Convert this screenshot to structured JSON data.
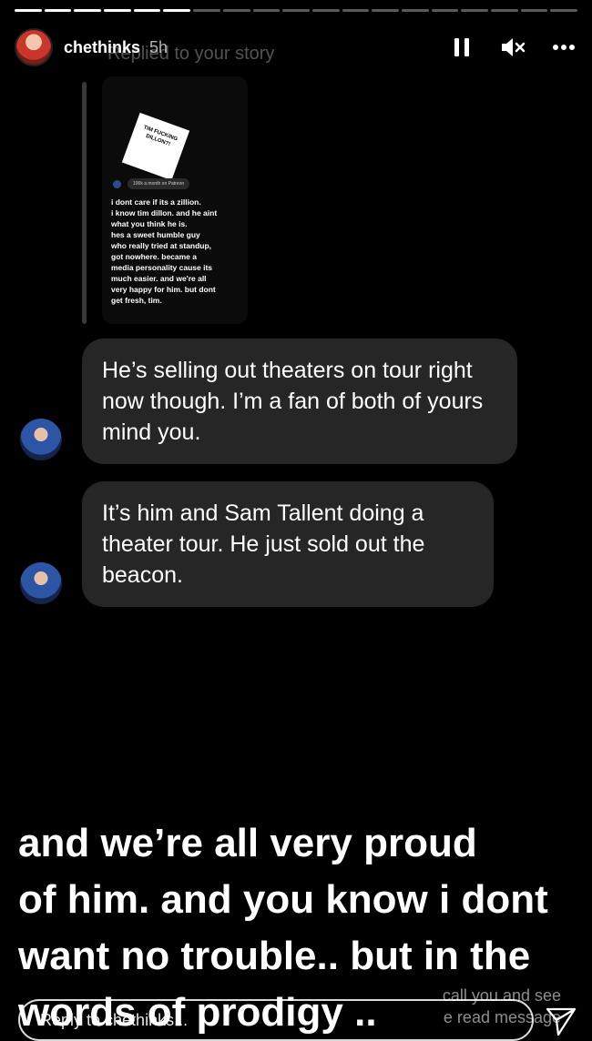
{
  "progress": {
    "segments": 19,
    "completed": 6
  },
  "header": {
    "username": "chethinks",
    "time_ago": "5h",
    "replied_to": "Replied to your story"
  },
  "quoted_story": {
    "mini_top": "",
    "mini_time": "",
    "mini_reply": "",
    "mini_story_text": "TIM FUCKING DILLON?!",
    "mini_pill": "100k a month on Patreon",
    "text_lines": [
      "i dont care if its a zillion.",
      "i know tim dillon. and he aint",
      "what you think he is.",
      "hes a sweet humble guy",
      "who really tried at standup,",
      "got nowhere. became a",
      "media personality cause its",
      "much easier. and we're all",
      "very happy for him. but dont",
      "get fresh, tim."
    ]
  },
  "messages": [
    {
      "text": "He’s selling out theaters on tour right now though. I’m a fan of both of yours mind you."
    },
    {
      "text": "It’s him and Sam Tallent doing a theater tour. He just sold out the beacon."
    }
  ],
  "caption": {
    "lines": [
      "and we’re all very proud",
      "of him. and you know i dont",
      "want no trouble.. but in the",
      "words of prodigy .."
    ]
  },
  "ghost_text": [
    "call you and see",
    "e read message"
  ],
  "reply": {
    "placeholder": "Reply to chethinks..."
  },
  "colors": {
    "background": "#000000",
    "bubble": "#262626",
    "text": "#ffffff"
  }
}
